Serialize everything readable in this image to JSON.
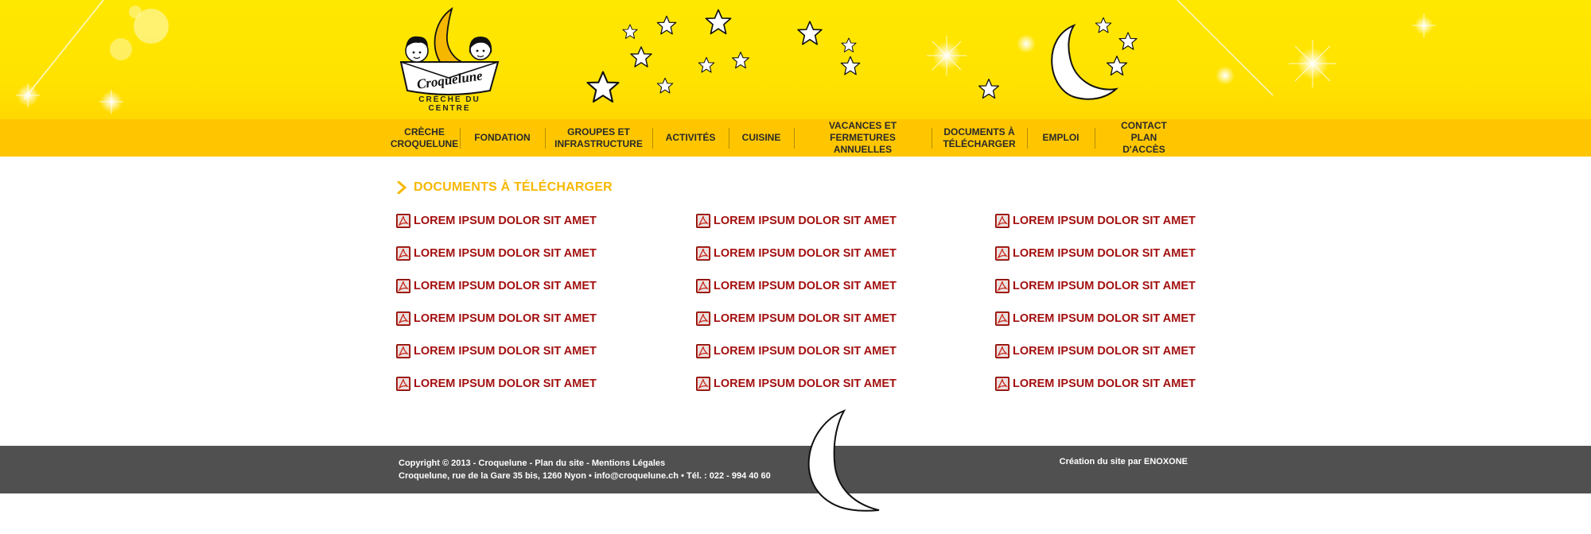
{
  "header": {
    "logo": {
      "brand": "Croquelune",
      "tagline": "CRÈCHE DU CENTRE",
      "icon": "paper-boat-moon-kids-logo"
    }
  },
  "nav": {
    "items": [
      {
        "label": "CRÈCHE\nCROQUELUNE"
      },
      {
        "label": "FONDATION"
      },
      {
        "label": "GROUPES ET\nINFRASTRUCTURE"
      },
      {
        "label": "ACTIVITÉS"
      },
      {
        "label": "CUISINE"
      },
      {
        "label": "VACANCES ET\nFERMETURES ANNUELLES"
      },
      {
        "label": "DOCUMENTS À\nTÉLÉCHARGER"
      },
      {
        "label": "EMPLOI"
      },
      {
        "label": "CONTACT\nPLAN  D'ACCÈS"
      }
    ]
  },
  "main": {
    "title": "DOCUMENTS À TÉLÉCHARGER",
    "documents": [
      {
        "label": "LOREM IPSUM DOLOR SIT AMET",
        "icon": "pdf-icon"
      },
      {
        "label": "LOREM IPSUM DOLOR SIT AMET",
        "icon": "pdf-icon"
      },
      {
        "label": "LOREM IPSUM DOLOR SIT AMET",
        "icon": "pdf-icon"
      },
      {
        "label": "LOREM IPSUM DOLOR SIT AMET",
        "icon": "pdf-icon"
      },
      {
        "label": "LOREM IPSUM DOLOR SIT AMET",
        "icon": "pdf-icon"
      },
      {
        "label": "LOREM IPSUM DOLOR SIT AMET",
        "icon": "pdf-icon"
      },
      {
        "label": "LOREM IPSUM DOLOR SIT AMET",
        "icon": "pdf-icon"
      },
      {
        "label": "LOREM IPSUM DOLOR SIT AMET",
        "icon": "pdf-icon"
      },
      {
        "label": "LOREM IPSUM DOLOR SIT AMET",
        "icon": "pdf-icon"
      },
      {
        "label": "LOREM IPSUM DOLOR SIT AMET",
        "icon": "pdf-icon"
      },
      {
        "label": "LOREM IPSUM DOLOR SIT AMET",
        "icon": "pdf-icon"
      },
      {
        "label": "LOREM IPSUM DOLOR SIT AMET",
        "icon": "pdf-icon"
      },
      {
        "label": "LOREM IPSUM DOLOR SIT AMET",
        "icon": "pdf-icon"
      },
      {
        "label": "LOREM IPSUM DOLOR SIT AMET",
        "icon": "pdf-icon"
      },
      {
        "label": "LOREM IPSUM DOLOR SIT AMET",
        "icon": "pdf-icon"
      },
      {
        "label": "LOREM IPSUM DOLOR SIT AMET",
        "icon": "pdf-icon"
      },
      {
        "label": "LOREM IPSUM DOLOR SIT AMET",
        "icon": "pdf-icon"
      },
      {
        "label": "LOREM IPSUM DOLOR SIT AMET",
        "icon": "pdf-icon"
      }
    ]
  },
  "footer": {
    "copyright": "Copyright © 2013 - Croquelune",
    "sep1": " - ",
    "sitemap": "Plan du site",
    "sep2": " - ",
    "legal": "Mentions Légales",
    "address": "Croquelune, rue de la Gare 35 bis, 1260 Nyon • ",
    "email": "info@croquelune.ch",
    "phone": " • Tél. : 022 - 994 40 60",
    "credit": "Création du site par ENOXONE"
  },
  "colors": {
    "header_yellow": "#ffe600",
    "nav_yellow": "#ffc600",
    "title_orange": "#f7b800",
    "link_red": "#a30f0f",
    "footer_gray": "#505050"
  }
}
